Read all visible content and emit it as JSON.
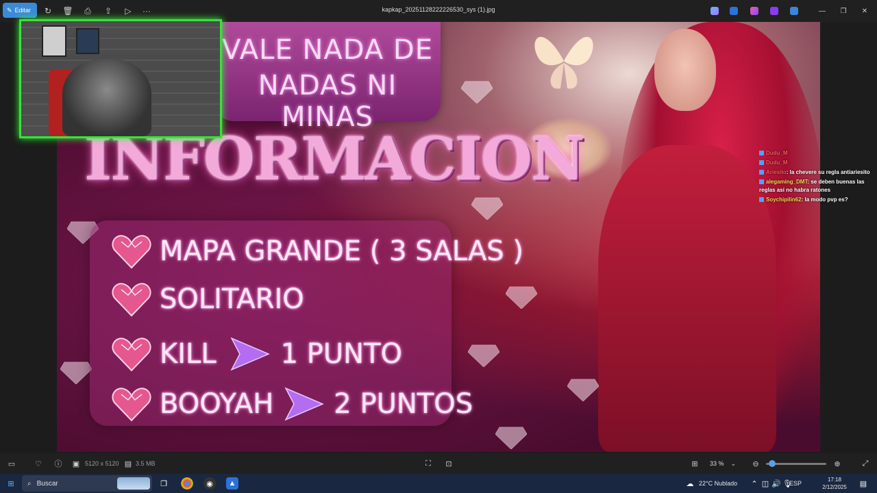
{
  "window": {
    "title": "kapkap_20251128222226530_sys (1).jpg",
    "edit_label": "Editar",
    "more_label": "···"
  },
  "image_content": {
    "banner_line1": "VALE NADA DE",
    "banner_line2": "NADAS NI MINAS",
    "title": "INFORMACION",
    "rules": [
      {
        "text": "MAPA GRANDE ( 3 SALAS )"
      },
      {
        "text": "SOLITARIO"
      },
      {
        "text": "KILL",
        "value": "1 PUNTO"
      },
      {
        "text": "BOOYAH",
        "value": "2 PUNTOS"
      }
    ]
  },
  "chat": [
    {
      "user": "Dudu_M",
      "message": ""
    },
    {
      "user": "Dudu_M",
      "message": ""
    },
    {
      "user": "Ariesito",
      "message": ": la chevere su regla antiariesito"
    },
    {
      "user": "alegaming_DMT",
      "message": ": se deben buenas las reglas asi no habra ratones"
    },
    {
      "user": "Soychipilin62",
      "message": ": la modo pvp es?"
    }
  ],
  "status_bar": {
    "dimensions": "5120 x 5120",
    "file_size": "3.5 MB",
    "zoom": "33 %",
    "zoom_level": 0.1
  },
  "taskbar": {
    "search_placeholder": "Buscar",
    "weather": "22°C  Nublado",
    "language": "ESP",
    "time": "17:18",
    "date": "2/12/2025"
  }
}
